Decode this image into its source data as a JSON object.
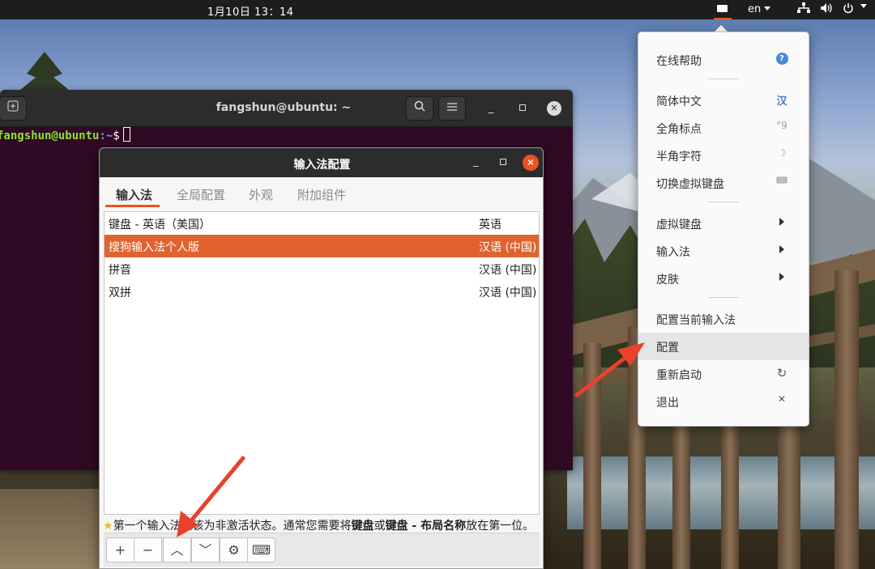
{
  "topbar": {
    "clock": "1月10日  13：14",
    "lang": "en"
  },
  "icons": {
    "keyboard_indicator": "keyboard-indicator-icon",
    "network": "network-icon",
    "volume": "volume-icon",
    "power": "power-icon"
  },
  "terminal": {
    "title": "fangshun@ubuntu: ~",
    "prompt_user": "fangshun@ubuntu",
    "prompt_path": ":~",
    "prompt_symbol": "$"
  },
  "dialog": {
    "title": "输入法配置",
    "tabs": [
      "输入法",
      "全局配置",
      "外观",
      "附加组件"
    ],
    "active_tab": "输入法",
    "rows": [
      {
        "name": "键盘 - 英语（美国）",
        "lang": "英语",
        "selected": false
      },
      {
        "name": "搜狗输入法个人版",
        "lang": "汉语 (中国)",
        "selected": true
      },
      {
        "name": "拼音",
        "lang": "汉语 (中国)",
        "selected": false
      },
      {
        "name": "双拼",
        "lang": "汉语 (中国)",
        "selected": false
      }
    ],
    "hint": {
      "part1": "第一个输入法应该为非激活状态。通常您需要将",
      "bold1": "键盘",
      "part2": "或",
      "bold2": "键盘 - 布局名称",
      "part3": "放在第一位。"
    },
    "toolbar": [
      "+",
      "−",
      "︿",
      "﹀",
      "⚙",
      "⌨"
    ]
  },
  "tray_menu": {
    "items": [
      {
        "label": "在线帮助",
        "icon": "help-icon"
      },
      {
        "label": "简体中文",
        "icon": "han-icon"
      },
      {
        "label": "全角标点",
        "icon": "fullwidth-punct-icon"
      },
      {
        "label": "半角字符",
        "icon": "halfwidth-char-icon"
      },
      {
        "label": "切换虚拟键盘",
        "icon": "keyboard-icon"
      },
      {
        "label": "虚拟键盘",
        "icon": "submenu-arrow-icon"
      },
      {
        "label": "输入法",
        "icon": "submenu-arrow-icon"
      },
      {
        "label": "皮肤",
        "icon": "submenu-arrow-icon"
      },
      {
        "label": "配置当前输入法",
        "icon": ""
      },
      {
        "label": "配置",
        "icon": ""
      },
      {
        "label": "重新启动",
        "icon": "reload-icon"
      },
      {
        "label": "退出",
        "icon": "close-icon"
      }
    ],
    "han_glyph": "汉",
    "highlighted": "配置"
  },
  "colors": {
    "accent": "#e95420",
    "selection": "#e0632f",
    "terminal_bg": "#300a24",
    "annotation": "#e8412c"
  }
}
